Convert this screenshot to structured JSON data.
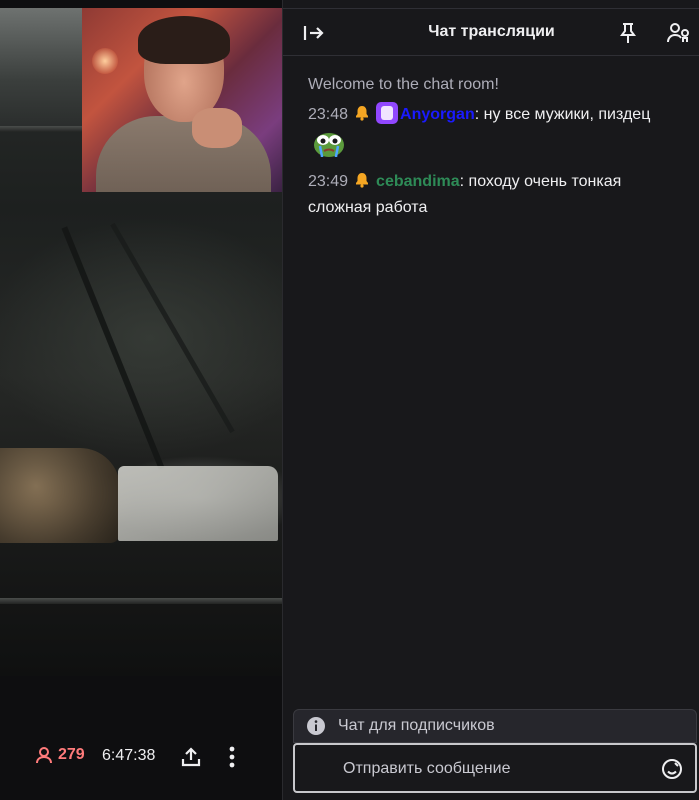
{
  "stream": {
    "viewer_count": "279",
    "uptime": "6:47:38"
  },
  "chat": {
    "title": "Чат трансляции",
    "welcome": "Welcome to the chat room!",
    "messages": [
      {
        "time": "23:48",
        "user": "Anyorgan",
        "user_color": "#1a1aff",
        "text": "ну все мужики, пиздец",
        "emote": "pepe-cry-emote"
      },
      {
        "time": "23:49",
        "user": "cebandima",
        "user_color": "#2e8b57",
        "text": "походу очень тонкая сложная работа"
      }
    ],
    "subscribers_only": "Чат для подписчиков",
    "input_placeholder": "Отправить сообщение"
  },
  "colors": {
    "viewer": "#ff7b7b",
    "background": "#18181b",
    "accent": "#9147ff"
  },
  "icons": [
    "collapse-chat-icon",
    "pin-icon",
    "users-icon",
    "viewer-icon",
    "share-icon",
    "more-icon",
    "info-icon",
    "emote-picker-icon",
    "bell-badge-icon",
    "sub-badge-icon"
  ]
}
